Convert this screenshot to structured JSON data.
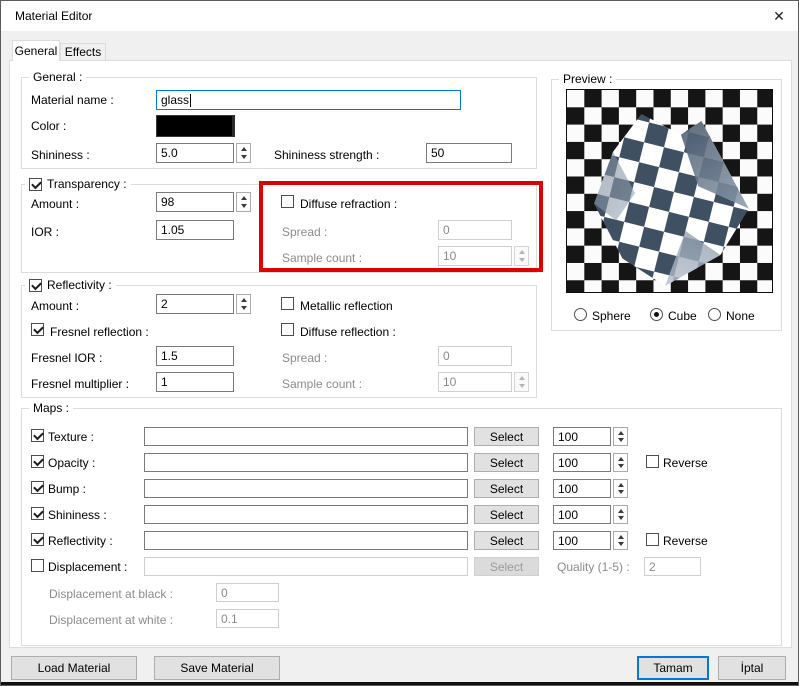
{
  "window": {
    "title": "Material Editor",
    "close_glyph": "✕"
  },
  "tabs": {
    "general": "General",
    "effects": "Effects"
  },
  "general": {
    "legend": "General :",
    "material_name_label": "Material name :",
    "material_name_value": "glass",
    "color_label": "Color :",
    "color_value": "#000000",
    "shininess_label": "Shininess :",
    "shininess_value": "5.0",
    "shininess_strength_label": "Shininess strength :",
    "shininess_strength_value": "50"
  },
  "transparency": {
    "legend": "Transparency :",
    "checked": true,
    "amount_label": "Amount :",
    "amount_value": "98",
    "ior_label": "IOR :",
    "ior_value": "1.05",
    "diffuse_refraction_label": "Diffuse refraction :",
    "diffuse_refraction_checked": false,
    "spread_label": "Spread :",
    "spread_value": "0",
    "sample_count_label": "Sample count :",
    "sample_count_value": "10"
  },
  "reflectivity": {
    "legend": "Reflectivity :",
    "checked": true,
    "amount_label": "Amount :",
    "amount_value": "2",
    "metallic_label": "Metallic reflection",
    "metallic_checked": false,
    "fresnel_label": "Fresnel reflection :",
    "fresnel_checked": true,
    "diffuse_label": "Diffuse reflection :",
    "diffuse_checked": false,
    "fresnel_ior_label": "Fresnel IOR :",
    "fresnel_ior_value": "1.5",
    "fresnel_multiplier_label": "Fresnel multiplier :",
    "fresnel_multiplier_value": "1",
    "spread_label": "Spread :",
    "spread_value": "0",
    "sample_count_label": "Sample count :",
    "sample_count_value": "10"
  },
  "maps": {
    "legend": "Maps :",
    "select_label": "Select",
    "reverse_label": "Reverse",
    "rows": [
      {
        "label": "Texture :",
        "checked": true,
        "value": "",
        "amount": "100"
      },
      {
        "label": "Opacity :",
        "checked": true,
        "value": "",
        "amount": "100",
        "reverse": false
      },
      {
        "label": "Bump :",
        "checked": true,
        "value": "",
        "amount": "100"
      },
      {
        "label": "Shininess :",
        "checked": true,
        "value": "",
        "amount": "100"
      },
      {
        "label": "Reflectivity :",
        "checked": true,
        "value": "",
        "amount": "100",
        "reverse": false
      },
      {
        "label": "Displacement :",
        "checked": false,
        "value": ""
      }
    ],
    "quality_label": "Quality (1-5) :",
    "quality_value": "2",
    "disp_black_label": "Displacement at black :",
    "disp_black_value": "0",
    "disp_white_label": "Displacement at white :",
    "disp_white_value": "0.1"
  },
  "preview": {
    "legend": "Preview :",
    "options": [
      {
        "label": "Sphere",
        "selected": false
      },
      {
        "label": "Cube",
        "selected": true
      },
      {
        "label": "None",
        "selected": false
      }
    ]
  },
  "footer": {
    "load": "Load Material",
    "save": "Save Material",
    "ok": "Tamam",
    "cancel": "İptal"
  },
  "colors": {
    "accent": "#0078d7",
    "highlight": "#dd0000",
    "swatch": "#000000"
  }
}
